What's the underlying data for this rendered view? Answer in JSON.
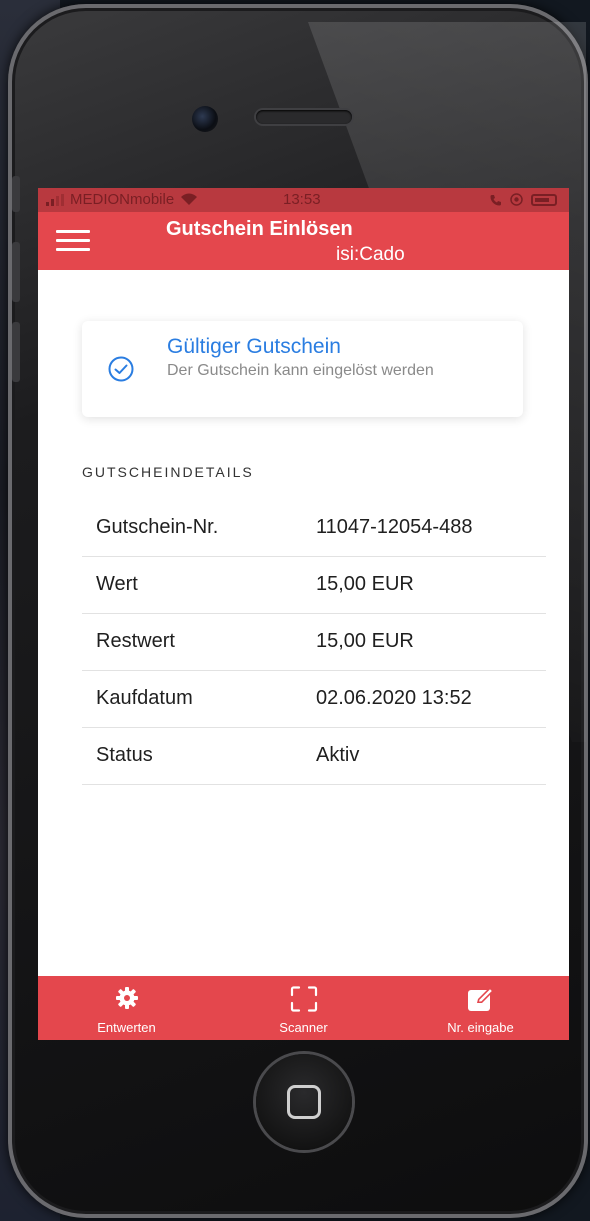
{
  "status_bar": {
    "carrier": "MEDIONmobile",
    "time": "13:53"
  },
  "app_bar": {
    "title": "Gutschein Einlösen",
    "subtitle": "isi:Cado"
  },
  "validation_card": {
    "title": "Gültiger Gutschein",
    "message": "Der Gutschein kann eingelöst werden"
  },
  "details": {
    "section_title": "GUTSCHEINDETAILS",
    "rows": [
      {
        "label": "Gutschein-Nr.",
        "value": "11047-12054-488"
      },
      {
        "label": "Wert",
        "value": "15,00 EUR"
      },
      {
        "label": "Restwert",
        "value": "15,00 EUR"
      },
      {
        "label": "Kaufdatum",
        "value": "02.06.2020 13:52"
      },
      {
        "label": "Status",
        "value": "Aktiv"
      }
    ]
  },
  "tab_bar": {
    "items": [
      {
        "label": "Entwerten",
        "icon": "gear-icon"
      },
      {
        "label": "Scanner",
        "icon": "scan-frame-icon"
      },
      {
        "label": "Nr. eingabe",
        "icon": "edit-icon"
      }
    ]
  },
  "colors": {
    "brand_red": "#e4474d",
    "status_bar_red": "#b8393f",
    "accent_blue": "#2a7de1",
    "muted_text": "#8a8a8a"
  }
}
